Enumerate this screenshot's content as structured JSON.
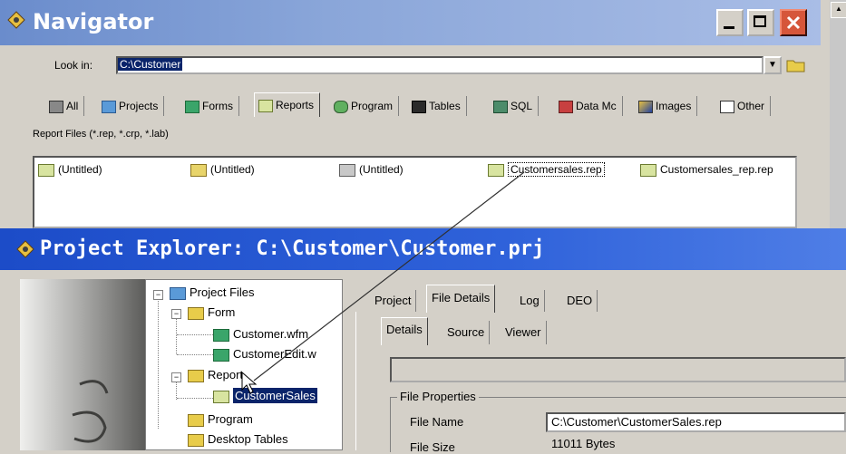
{
  "navigator": {
    "title": "Navigator",
    "look_in_label": "Look in:",
    "look_in_value": "C:\\Customer",
    "tabs": [
      {
        "label": "All",
        "icon": "all-icon"
      },
      {
        "label": "Projects",
        "icon": "projects-icon"
      },
      {
        "label": "Forms",
        "icon": "forms-icon"
      },
      {
        "label": "Reports",
        "icon": "reports-icon",
        "active": true
      },
      {
        "label": "Program",
        "icon": "program-icon"
      },
      {
        "label": "Tables",
        "icon": "tables-icon"
      },
      {
        "label": "SQL",
        "icon": "sql-icon"
      },
      {
        "label": "Data Mc",
        "icon": "datamodule-icon"
      },
      {
        "label": "Images",
        "icon": "images-icon"
      },
      {
        "label": "Other",
        "icon": "other-icon"
      }
    ],
    "filter_text": "Report Files (*.rep, *.crp, *.lab)",
    "files": [
      {
        "label": "(Untitled)",
        "icon": "report-icon"
      },
      {
        "label": "(Untitled)",
        "icon": "crystal-report-icon"
      },
      {
        "label": "(Untitled)",
        "icon": "label-icon"
      },
      {
        "label": "Customersales.rep",
        "icon": "report-icon",
        "selected": true
      },
      {
        "label": "Customersales_rep.rep",
        "icon": "report-icon"
      }
    ]
  },
  "explorer": {
    "title": "Project Explorer: C:\\Customer\\Customer.prj",
    "tree": {
      "root": "Project Files",
      "form_folder": "Form",
      "form_items": [
        "Customer.wfm",
        "CustomerEdit.w"
      ],
      "report_folder": "Report",
      "report_items": [
        "CustomerSales"
      ],
      "program_folder": "Program",
      "tables_folder": "Desktop Tables"
    },
    "tabs": [
      "Project",
      "File Details",
      "Log",
      "DEO"
    ],
    "active_tab": "File Details",
    "subtabs": [
      "Details",
      "Source",
      "Viewer"
    ],
    "active_subtab": "Details",
    "file_properties_label": "File Properties",
    "file_name_label": "File Name",
    "file_name_value": "C:\\Customer\\CustomerSales.rep",
    "file_size_label": "File Size",
    "file_size_value": "11011 Bytes"
  },
  "colors": {
    "navigator_title": "#8aa6d9",
    "explorer_title": "#2f62da",
    "selection": "#0a246a"
  }
}
